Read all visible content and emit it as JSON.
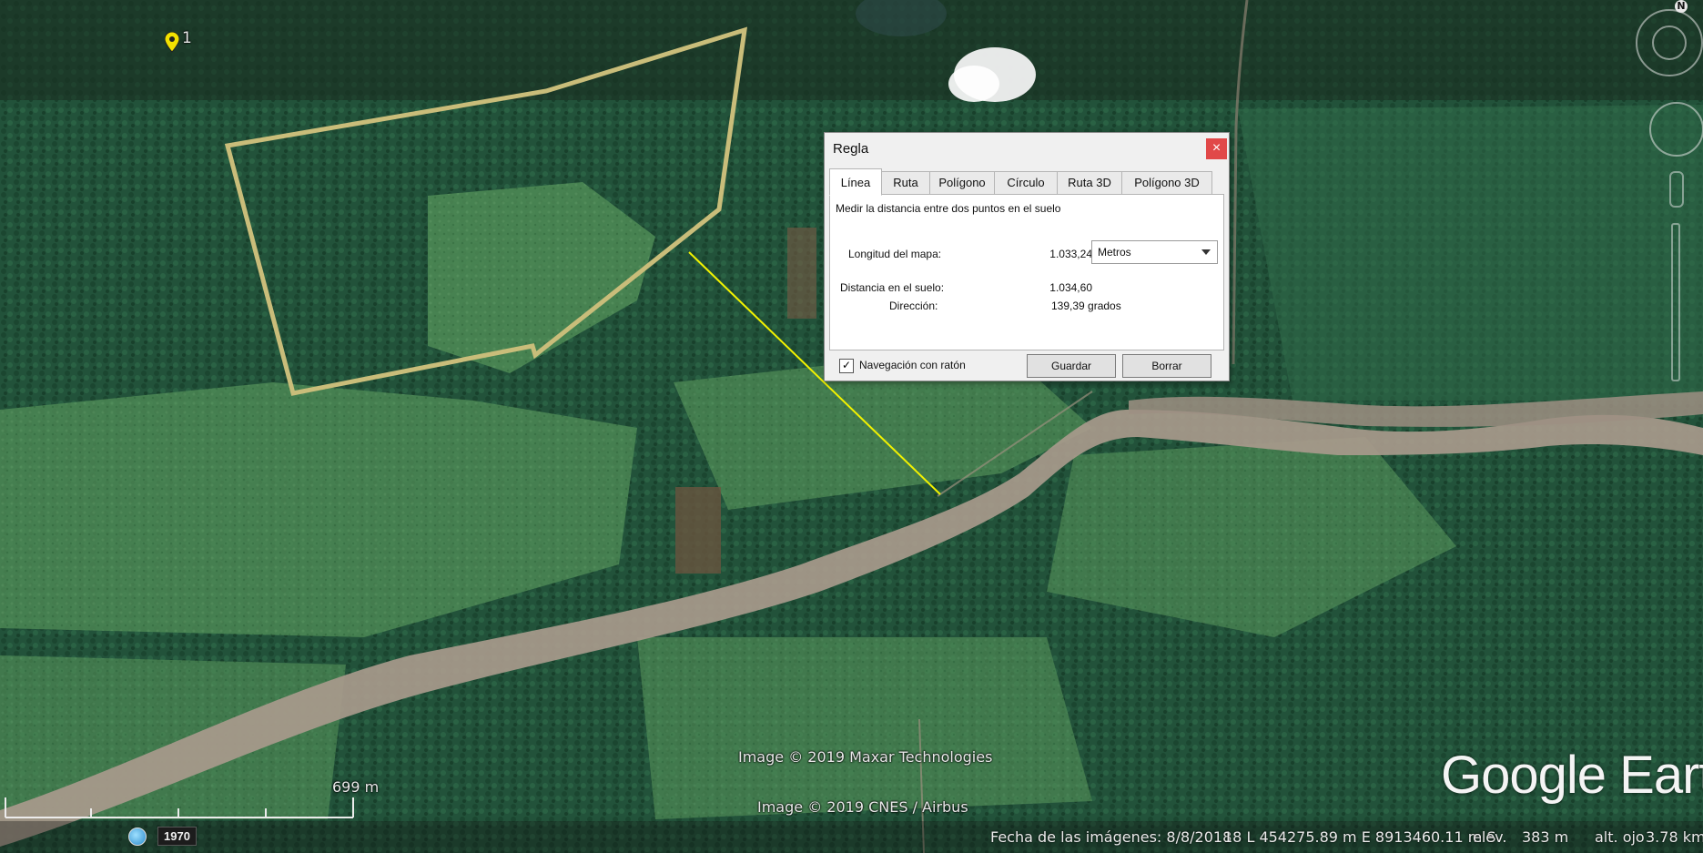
{
  "map": {
    "placemark_label": "1",
    "attribution_1": "Image © 2019 Maxar Technologies",
    "attribution_2": "Image © 2019 CNES / Airbus",
    "logo": "Google Earth",
    "scale_label": "699 m",
    "compass_label": "N",
    "ruler_line_color": "#f2f200",
    "polygon_color": "#c9bd7a"
  },
  "status": {
    "history_year": "1970",
    "imagery_date": "Fecha de las imágenes: 8/8/2018",
    "coordinates": "18 L 454275.89 m E 8913460.11 m S",
    "elevation_label": "elev.",
    "elevation_value": "383 m",
    "eye_alt_label": "alt. ojo",
    "eye_alt_value": "3.78 km"
  },
  "dialog": {
    "title": "Regla",
    "close": "×",
    "tabs": [
      "Línea",
      "Ruta",
      "Polígono",
      "Círculo",
      "Ruta 3D",
      "Polígono 3D"
    ],
    "active_tab": "Línea",
    "description": "Medir la distancia entre dos puntos en el suelo",
    "map_length_label": "Longitud del mapa:",
    "map_length_value": "1.033,24",
    "unit": "Metros",
    "ground_distance_label": "Distancia en el suelo:",
    "ground_distance_value": "1.034,60",
    "direction_label": "Dirección:",
    "direction_value": "139,39 grados",
    "mouse_nav_label": "Navegación con ratón",
    "mouse_nav_checked": "✓",
    "save_button": "Guardar",
    "clear_button": "Borrar"
  }
}
